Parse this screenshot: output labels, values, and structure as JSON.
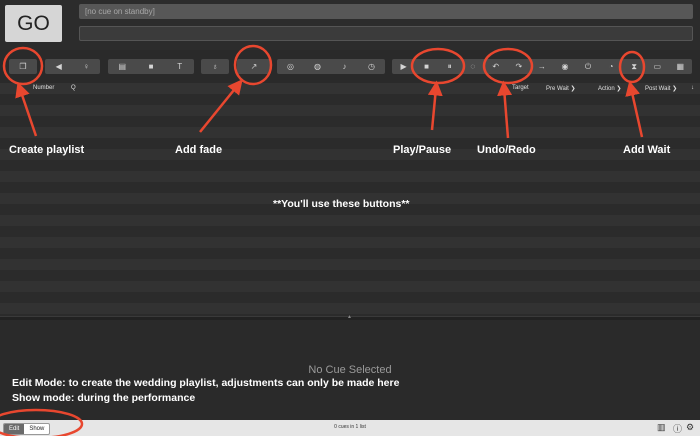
{
  "go": {
    "label": "GO"
  },
  "standby": {
    "text": "[no cue on standby]"
  },
  "toolbar": {
    "group1": [
      {
        "icon": "group-icon",
        "glyph": "❐"
      }
    ],
    "group2": [
      {
        "icon": "speaker-icon",
        "glyph": "◀"
      },
      {
        "icon": "microphone-icon",
        "glyph": "♀"
      }
    ],
    "group3": [
      {
        "icon": "film-icon",
        "glyph": "▤"
      },
      {
        "icon": "camera-icon",
        "glyph": "■"
      },
      {
        "icon": "text-icon",
        "glyph": "T"
      }
    ],
    "group4": [
      {
        "icon": "light-bulb-icon",
        "glyph": "♁"
      }
    ],
    "group5": [
      {
        "icon": "fade-icon",
        "glyph": "↗"
      }
    ],
    "group6": [
      {
        "icon": "network-icon",
        "glyph": "◎"
      },
      {
        "icon": "midi-icon",
        "glyph": "◍"
      },
      {
        "icon": "music-note-icon",
        "glyph": "♪"
      },
      {
        "icon": "clock-icon",
        "glyph": "◷"
      }
    ],
    "group7": [
      {
        "icon": "play-icon",
        "glyph": "▶"
      },
      {
        "icon": "stop-icon",
        "glyph": "■"
      },
      {
        "icon": "pause-icon",
        "glyph": "⏸"
      },
      {
        "icon": "hard-stop-icon",
        "glyph": "◌"
      },
      {
        "icon": "undo-icon",
        "glyph": "↶"
      },
      {
        "icon": "redo-icon",
        "glyph": "↷"
      },
      {
        "icon": "goto-icon",
        "glyph": "→"
      },
      {
        "icon": "target-icon",
        "glyph": "◉"
      },
      {
        "icon": "power-icon",
        "glyph": "⏻"
      },
      {
        "icon": "gauge-icon",
        "glyph": "◔"
      },
      {
        "icon": "hourglass-icon",
        "glyph": "⧗"
      },
      {
        "icon": "memo-icon",
        "glyph": "▭"
      },
      {
        "icon": "script-icon",
        "glyph": "▦"
      }
    ]
  },
  "columns": {
    "number": "Number",
    "q": "Q",
    "target": "Target",
    "pre_wait": "Pre Wait",
    "action": "Action",
    "post_wait": "Post Wait"
  },
  "annotations": {
    "create_playlist": "Create playlist",
    "add_fade": "Add fade",
    "play_pause": "Play/Pause",
    "undo_redo": "Undo/Redo",
    "add_wait": "Add Wait",
    "use_buttons": "**You'll use these buttons**"
  },
  "inspector": {
    "empty_text": "No Cue Selected"
  },
  "notes": {
    "line1": "Edit Mode: to create the wedding playlist, adjustments can only be made here",
    "line2": "Show mode: during the performance"
  },
  "statusbar": {
    "edit": "Edit",
    "show": "Show",
    "count": "0 cues in 1 list"
  },
  "colors": {
    "annotation": "#e8472f",
    "go_button": "#d6d6d6"
  }
}
